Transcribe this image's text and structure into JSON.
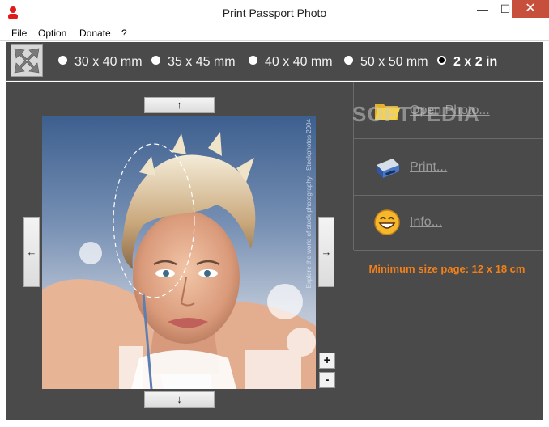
{
  "window": {
    "title": "Print Passport Photo",
    "min": "—",
    "max": "☐",
    "close": "✕"
  },
  "menu": {
    "file": "File",
    "option": "Option",
    "donate": "Donate",
    "help": "?"
  },
  "sizes": [
    {
      "label": "30 x 40 mm",
      "selected": false
    },
    {
      "label": "35 x 45 mm",
      "selected": false
    },
    {
      "label": "40 x 40 mm",
      "selected": false
    },
    {
      "label": "50 x 50 mm",
      "selected": false
    },
    {
      "label": "2 x 2 in",
      "selected": true
    }
  ],
  "nav": {
    "up": "↑",
    "down": "↓",
    "left": "←",
    "right": "→",
    "zoom_in": "+",
    "zoom_out": "-"
  },
  "actions": {
    "open_photo": "Open Photo...",
    "print": "Print...",
    "info": "Info..."
  },
  "watermark": "SOFTPEDIA",
  "photo_watermark": "Explore the world of stock photography - Stockphotos 2004",
  "min_size": "Minimum size page: 12 x 18 cm",
  "colors": {
    "accent_orange": "#f0801a",
    "panel": "#4a4a4a",
    "close": "#c7503d"
  }
}
